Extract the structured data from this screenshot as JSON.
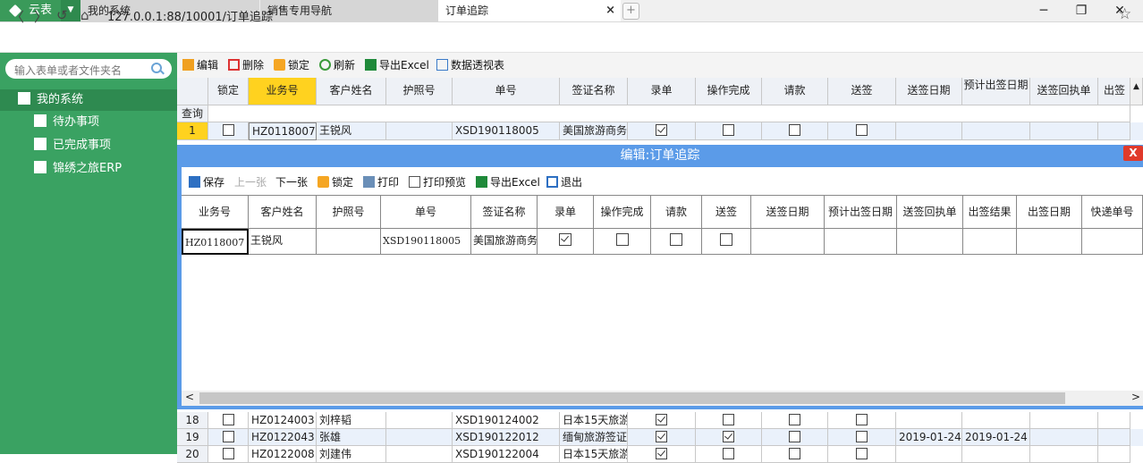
{
  "tabbar": {
    "app_name": "云表",
    "tabs": [
      {
        "label": "我的系统"
      },
      {
        "label": "销售专用导航"
      },
      {
        "label": "订单追踪"
      }
    ],
    "close_glyph": "×",
    "new_tab_glyph": "+",
    "win": {
      "min": "─",
      "max": "❐",
      "close": "✕"
    }
  },
  "address": {
    "url": "127.0.0.1:88/10001/订单追踪"
  },
  "sidebar": {
    "search_placeholder": "输入表单或者文件夹名",
    "items": [
      {
        "label": "我的系统"
      },
      {
        "label": "待办事项"
      },
      {
        "label": "已完成事项"
      },
      {
        "label": "锦绣之旅ERP"
      }
    ]
  },
  "toolbar": {
    "edit": "编辑",
    "delete": "删除",
    "lock": "锁定",
    "refresh": "刷新",
    "export": "导出Excel",
    "pivot": "数据透视表"
  },
  "grid": {
    "columns": [
      "锁定",
      "业务号",
      "客户姓名",
      "护照号",
      "单号",
      "签证名称",
      "录单",
      "操作完成",
      "请款",
      "送签",
      "送签日期",
      "预计出签日期",
      "送签回执单",
      "出签"
    ],
    "query_label": "查询",
    "rows_top": [
      {
        "n": "1",
        "lock": false,
        "biz": "HZ0118007",
        "cust": "王锐风",
        "passport": "",
        "order": "XSD190118005",
        "visa": "美国旅游商务",
        "entry": true,
        "done": false,
        "pay": false,
        "send": false,
        "send_date": "",
        "exp_date": ""
      }
    ],
    "rows_bottom": [
      {
        "n": "18",
        "lock": false,
        "biz": "HZ0124003",
        "cust": "刘梓韬",
        "passport": "",
        "order": "XSD190124002",
        "visa": "日本15天旅游",
        "entry": true,
        "done": false,
        "pay": false,
        "send": false,
        "send_date": "",
        "exp_date": ""
      },
      {
        "n": "19",
        "lock": false,
        "biz": "HZ0122043",
        "cust": "张雄",
        "passport": "",
        "order": "XSD190122012",
        "visa": "缅甸旅游签证",
        "entry": true,
        "done": true,
        "pay": false,
        "send": false,
        "send_date": "2019-01-24",
        "exp_date": "2019-01-24"
      },
      {
        "n": "20",
        "lock": false,
        "biz": "HZ0122008",
        "cust": "刘建伟",
        "passport": "",
        "order": "XSD190122004",
        "visa": "日本15天旅游",
        "entry": true,
        "done": false,
        "pay": false,
        "send": false,
        "send_date": "",
        "exp_date": ""
      }
    ]
  },
  "modal": {
    "title": "编辑:订单追踪",
    "close_label": "X",
    "toolbar": {
      "save": "保存",
      "prev": "上一张",
      "next": "下一张",
      "lock": "锁定",
      "print": "打印",
      "preview": "打印预览",
      "export": "导出Excel",
      "exit": "退出"
    },
    "columns": [
      "业务号",
      "客户姓名",
      "护照号",
      "单号",
      "签证名称",
      "录单",
      "操作完成",
      "请款",
      "送签",
      "送签日期",
      "预计出签日期",
      "送签回执单",
      "出签结果",
      "出签日期",
      "快递单号"
    ],
    "row": {
      "biz": "HZ0118007",
      "cust": "王锐风",
      "passport": "",
      "order": "XSD190118005",
      "visa": "美国旅游商务",
      "entry": true,
      "done": false,
      "pay": false,
      "send": false
    },
    "scroll_left": "<",
    "scroll_right": ">"
  },
  "colors": {
    "accent": "#3aa262",
    "modal": "#5b9be8",
    "selected": "#ffd21f"
  }
}
